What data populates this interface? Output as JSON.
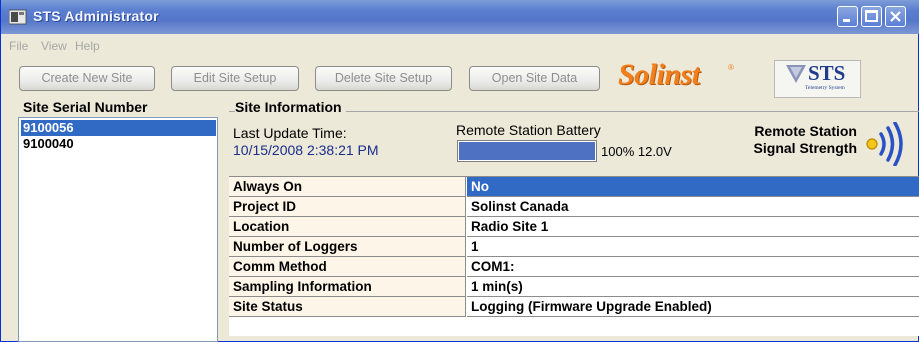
{
  "window": {
    "title": "STS Administrator"
  },
  "menu": [
    "File",
    "View",
    "Help"
  ],
  "toolbar": {
    "buttons": [
      "Create New Site",
      "Edit Site Setup",
      "Delete Site Setup",
      "Open Site Data"
    ]
  },
  "logos": {
    "solinst": "Solinst",
    "sts": "STS",
    "sts_sub": "Telemetry System"
  },
  "serials": {
    "heading": "Site Serial Number",
    "items": [
      "9100056",
      "9100040"
    ],
    "selected_index": 0
  },
  "site_info": {
    "heading": "Site Information",
    "last_update_label": "Last Update Time:",
    "last_update_value": "10/15/2008 2:38:21 PM",
    "battery_label": "Remote Station Battery",
    "battery_level": 1.0,
    "battery_value": "100% 12.0V",
    "signal_label_line1": "Remote Station",
    "signal_label_line2": "Signal Strength"
  },
  "properties": [
    {
      "key": "Always On",
      "value": "No",
      "selected": true
    },
    {
      "key": "Project ID",
      "value": "Solinst Canada",
      "selected": false
    },
    {
      "key": "Location",
      "value": "Radio Site 1",
      "selected": false
    },
    {
      "key": "Number of Loggers",
      "value": "1",
      "selected": false
    },
    {
      "key": "Comm Method",
      "value": "COM1:",
      "selected": false
    },
    {
      "key": "Sampling Information",
      "value": "1 min(s)",
      "selected": false
    },
    {
      "key": "Site Status",
      "value": "Logging (Firmware Upgrade Enabled)",
      "selected": false
    }
  ],
  "colors": {
    "selection": "#316ac5",
    "brand_orange": "#f07f1c",
    "titlebar": "#5b7fd0"
  }
}
